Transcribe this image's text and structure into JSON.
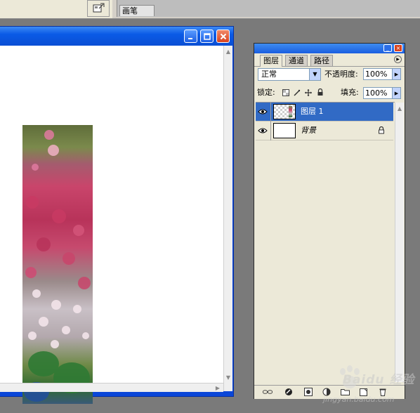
{
  "options_bar": {
    "palette_well_icon": "palette-well-icon",
    "brush_tab_label": "画笔"
  },
  "document_window": {
    "title": "",
    "controls": [
      "minimize",
      "maximize",
      "close"
    ]
  },
  "layers_panel": {
    "tabs": [
      {
        "label": "图层",
        "active": true
      },
      {
        "label": "通道",
        "active": false
      },
      {
        "label": "路径",
        "active": false
      }
    ],
    "blend_mode": "正常",
    "opacity_label": "不透明度:",
    "opacity_value": "100%",
    "lock_label": "锁定:",
    "fill_label": "填充:",
    "fill_value": "100%",
    "layers": [
      {
        "name": "图层 1",
        "selected": true,
        "visible": true,
        "locked": false
      },
      {
        "name": "背景",
        "selected": false,
        "visible": true,
        "locked": true
      }
    ],
    "bottom_icons": [
      "link-icon",
      "layer-style-icon",
      "mask-icon",
      "adjustment-icon",
      "folder-icon",
      "new-layer-icon",
      "trash-icon"
    ]
  },
  "watermark": {
    "brand": "Baidu 经验",
    "url": "jingyan.baidu.com"
  },
  "colors": {
    "xp_title_blue": "#0a5ae6",
    "selection_blue": "#316ac5",
    "panel_bg": "#ece9d8",
    "workspace_gray": "#7a7a7a"
  }
}
